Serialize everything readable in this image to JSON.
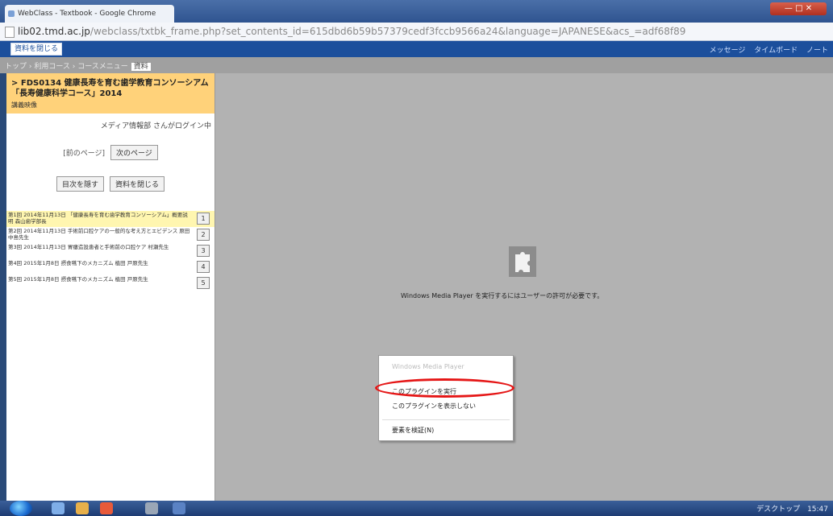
{
  "browser": {
    "tab_title": "WebClass - Textbook - Google Chrome",
    "window_controls": "— □ ✕",
    "url_host": "lib02.tmd.ac.jp",
    "url_path": "/webclass/txtbk_frame.php?set_contents_id=615dbd6b59b57379cedf3fccb9566a24&language=JAPANESE&acs_=adf68f89"
  },
  "toolbar": {
    "close_label": "資料を閉じる",
    "links": [
      "メッセージ",
      "タイムボード",
      "ノート"
    ]
  },
  "breadcrumb": {
    "path": "トップ › 利用コース › コースメニュー",
    "current": "資料"
  },
  "course": {
    "title": "> FDS0134 健康長寿を育む歯学教育コンソーシアム「長寿健康科学コース」2014",
    "subtitle": "講義映像",
    "login_status": "メディア情報部 さんがログイン中"
  },
  "pager": {
    "prev": "[前のページ]",
    "next": "次のページ"
  },
  "actions": {
    "hide_toc": "目次を隠す",
    "close_material": "資料を閉じる"
  },
  "toc": [
    {
      "text": "第1回 2014年11月13日 「健康長寿を育む歯学教育コンソーシアム」概要説明 森山歯学部長",
      "num": "1",
      "selected": true
    },
    {
      "text": "第2回 2014年11月13日 手術前口腔ケアの一般的な考え方とエビデンス 原田 中島先生",
      "num": "2",
      "selected": false
    },
    {
      "text": "第3回 2014年11月13日 胃瘻造設患者と手術前の口腔ケア 村瀬先生",
      "num": "3",
      "selected": false
    },
    {
      "text": "第4回 2015年1月8日 摂食嚥下のメカニズム 植田 戸原先生",
      "num": "4",
      "selected": false
    },
    {
      "text": "第5回 2015年1月8日 摂食嚥下のメカニズム 植田 戸原先生",
      "num": "5",
      "selected": false
    }
  ],
  "plugin": {
    "message": "Windows Media Player を実行するにはユーザーの許可が必要です。"
  },
  "context_menu": {
    "header": "Windows Media Player",
    "run": "このプラグインを実行",
    "hide": "このプラグインを表示しない",
    "inspect": "要素を検証(N)"
  },
  "taskbar": {
    "tray_items": [
      "デスクトップ",
      "15:47"
    ]
  },
  "colors": {
    "highlight_ring": "#e51616",
    "course_header_bg": "#ffd27a",
    "top_band": "#1c4f9c"
  }
}
